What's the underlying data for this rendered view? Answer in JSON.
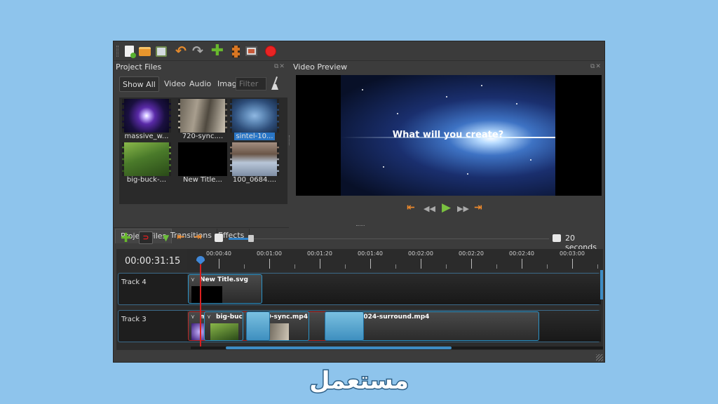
{
  "toolbar": {
    "buttons": [
      "new-project-icon",
      "open-project-icon",
      "save-project-icon",
      "undo-icon",
      "redo-icon",
      "import-files-icon",
      "profile-icon",
      "export-video-icon",
      "record-icon"
    ]
  },
  "project_files": {
    "title": "Project Files",
    "filters": [
      "Show All",
      "Video",
      "Audio",
      "Image"
    ],
    "filter_placeholder": "Filter",
    "files": [
      {
        "label": "massive_w...",
        "selected": false
      },
      {
        "label": "720-sync....",
        "selected": false
      },
      {
        "label": "sintel-10...",
        "selected": true
      },
      {
        "label": "big-buck-...",
        "selected": false
      },
      {
        "label": "New Title...",
        "selected": false
      },
      {
        "label": "100_0684....",
        "selected": false
      }
    ],
    "tabs": [
      "Project Files",
      "Transitions",
      "Effects"
    ]
  },
  "video_preview": {
    "title": "Video Preview",
    "caption": "What will you create?"
  },
  "timeline": {
    "zoom_label": "20 seconds",
    "current_time": "00:00:31:15",
    "ruler": [
      "00:00:40",
      "00:01:00",
      "00:01:20",
      "00:01:40",
      "00:02:00",
      "00:02:20",
      "00:02:40",
      "00:03:00"
    ],
    "tracks": [
      {
        "name": "Track 4",
        "clips": [
          {
            "name": "New Title.svg"
          }
        ]
      },
      {
        "name": "Track 3",
        "clips": [
          {
            "name": "m"
          },
          {
            "name": "big-buck-"
          },
          {
            "name": "720-sync.mp4"
          },
          {
            "name": "sintel-1024-surround.mp4"
          }
        ]
      }
    ]
  },
  "colors": {
    "accent": "#2f81c7",
    "window_bg": "#3c3c3c",
    "page_bg": "#8ec4ec",
    "playhead": "#d92020"
  },
  "watermark": {
    "text": "مستعمل"
  }
}
